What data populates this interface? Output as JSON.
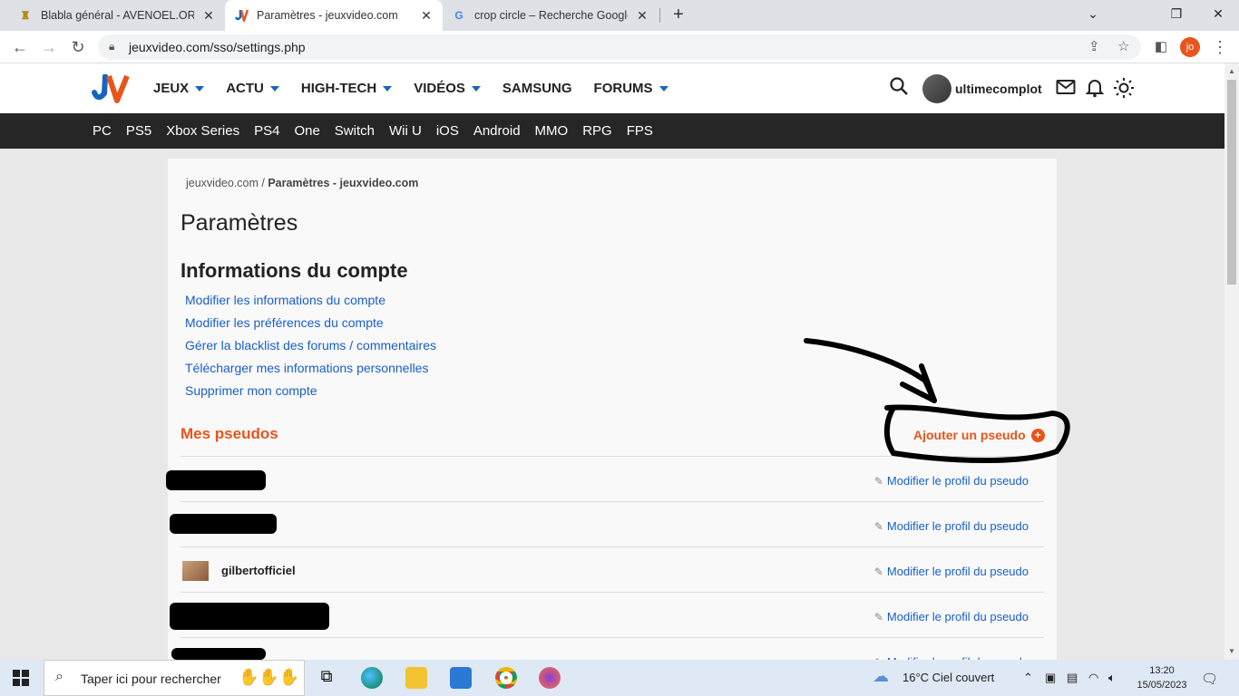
{
  "browser": {
    "tabs": [
      {
        "title": "Blabla général - AVENOEL.ORG -",
        "close": "✕"
      },
      {
        "title": "Paramètres - jeuxvideo.com",
        "close": "✕"
      },
      {
        "title": "crop circle – Recherche Google",
        "close": "✕"
      }
    ],
    "new_tab": "+",
    "url": "jeuxvideo.com/sso/settings.php",
    "profile_initials": "jo",
    "window_controls": {
      "minimize": "⌄",
      "restore": "❐",
      "close": "✕"
    }
  },
  "site": {
    "nav": [
      {
        "label": "JEUX",
        "dropdown": true
      },
      {
        "label": "ACTU",
        "dropdown": true
      },
      {
        "label": "HIGH-TECH",
        "dropdown": true
      },
      {
        "label": "VIDÉOS",
        "dropdown": true
      },
      {
        "label": "SAMSUNG",
        "dropdown": false
      },
      {
        "label": "FORUMS",
        "dropdown": true
      }
    ],
    "username": "ultimecomplot",
    "platforms": [
      "PC",
      "PS5",
      "Xbox Series",
      "PS4",
      "One",
      "Switch",
      "Wii U",
      "iOS",
      "Android",
      "MMO",
      "RPG",
      "FPS"
    ],
    "brand_color": "#e8541b",
    "link_color": "#1a5fc7"
  },
  "page": {
    "breadcrumb_root": "jeuxvideo.com",
    "breadcrumb_sep": " / ",
    "breadcrumb_current": "Paramètres - jeuxvideo.com",
    "title": "Paramètres",
    "account_heading": "Informations du compte",
    "account_links": [
      "Modifier les informations du compte",
      "Modifier les préférences du compte",
      "Gérer la blacklist des forums / commentaires",
      "Télécharger mes informations personnelles",
      "Supprimer mon compte"
    ],
    "pseudos_heading": "Mes pseudos",
    "add_pseudo": "Ajouter un pseudo",
    "pseudos": [
      {
        "name": "",
        "edit": "Modifier le profil du pseudo"
      },
      {
        "name": "",
        "edit": "Modifier le profil du pseudo"
      },
      {
        "name": "gilbertofficiel",
        "edit": "Modifier le profil du pseudo"
      },
      {
        "name": "",
        "edit": "Modifier le profil du pseudo"
      },
      {
        "name": "",
        "edit": "Modifier le profil du pseudo"
      }
    ]
  },
  "taskbar": {
    "search_placeholder": "Taper ici pour rechercher",
    "weather": "16°C  Ciel couvert",
    "time": "13:20",
    "date": "15/05/2023"
  }
}
